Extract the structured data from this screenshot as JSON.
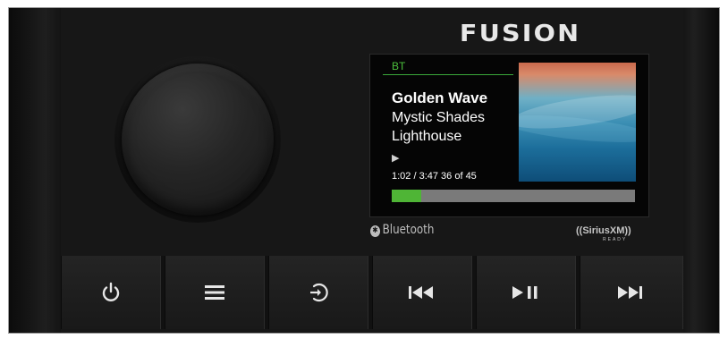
{
  "brand": {
    "logo": "FUSION"
  },
  "display": {
    "source": "BT",
    "song_title": "Golden Wave",
    "artist": "Mystic Shades",
    "album": "Lighthouse",
    "play_state_icon": "play-indicator-icon",
    "play_glyph": "▶",
    "time_elapsed": "1:02",
    "time_total": "3:47",
    "time_text": "1:02 / 3:47 36 of 45",
    "track_index": 36,
    "track_count": 45,
    "progress_fraction": 0.12,
    "progress_color": "#4fb536",
    "accent_color": "#4cbf3c"
  },
  "labels": {
    "bluetooth": "Bluetooth",
    "bluetooth_icon_glyph": "✱",
    "siriusxm": "((SiriusXM))",
    "siriusxm_ready": "READY"
  },
  "buttons": [
    {
      "name": "power",
      "icon": "power-icon"
    },
    {
      "name": "menu",
      "icon": "menu-icon"
    },
    {
      "name": "source",
      "icon": "source-icon"
    },
    {
      "name": "previous",
      "icon": "previous-track-icon"
    },
    {
      "name": "play-pause",
      "icon": "play-pause-icon"
    },
    {
      "name": "next",
      "icon": "next-track-icon"
    }
  ]
}
